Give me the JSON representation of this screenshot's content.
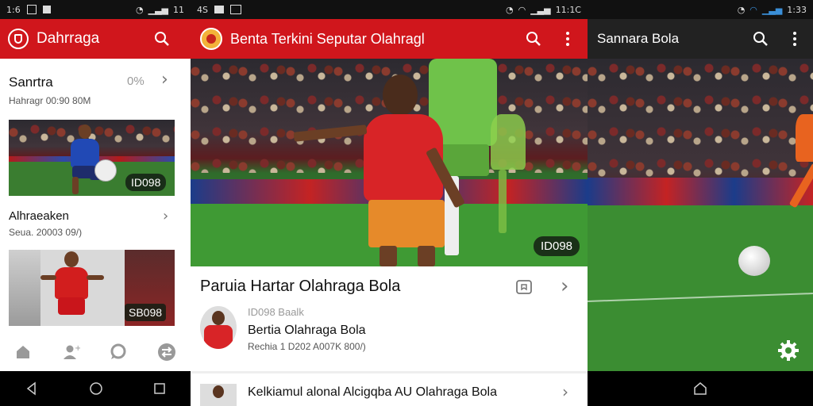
{
  "status_bars": {
    "left": {
      "time": "1:6",
      "signal": "11"
    },
    "middle": {
      "left_text": "4S",
      "right_text": "11:1C"
    },
    "right": {
      "right_text": "1:33"
    }
  },
  "panel_left": {
    "app_title": "Dahrraga",
    "section": {
      "title": "Sanrtra",
      "meta": "Hahragr 00:90 80M",
      "count": "0%",
      "items": [
        {
          "badge": "ID098"
        },
        {
          "title": "Alhraeaken",
          "meta": "Seua. 20003 09/)",
          "badge": "SB098"
        }
      ]
    },
    "bottom_nav": [
      "home-icon",
      "add-user-icon",
      "chat-icon",
      "transfer-icon"
    ]
  },
  "panel_middle": {
    "app_title": "Benta Terkini Seputar Olahragl",
    "hero_badge": "ID098",
    "card": {
      "heading": "Paruia Hartar Olahraga Bola",
      "item": {
        "source": "ID098 Baalk",
        "title": "Bertia Olahraga Bola",
        "meta": "Rechia 1 D202 A007K 800/)"
      }
    },
    "next_item": {
      "title": "Kelkiamul alonal Alcigqba AU Olahraga Bola"
    }
  },
  "panel_right": {
    "app_title": "Sannara Bola"
  },
  "colors": {
    "red_appbar": "#d0161c",
    "dark_appbar": "#222222",
    "white": "#ffffff"
  }
}
